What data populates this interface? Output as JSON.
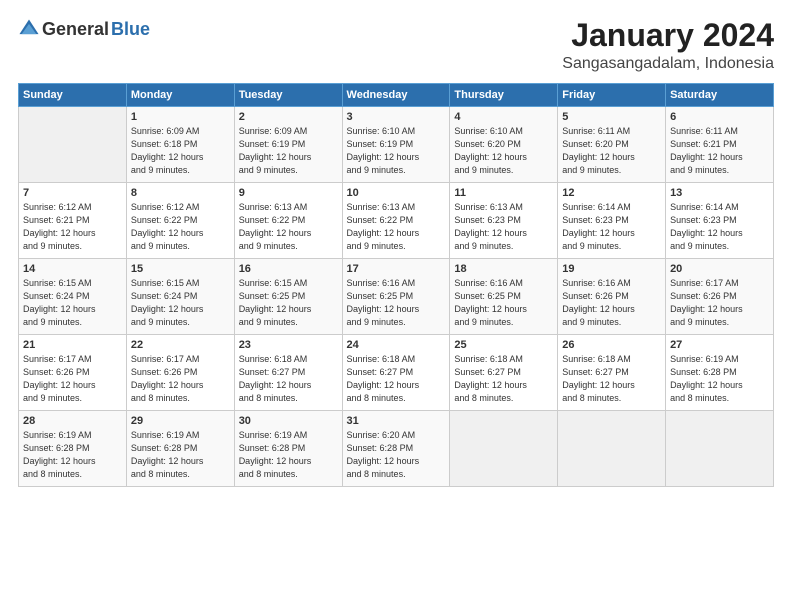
{
  "logo": {
    "text_general": "General",
    "text_blue": "Blue"
  },
  "header": {
    "month": "January 2024",
    "location": "Sangasangadalam, Indonesia"
  },
  "weekdays": [
    "Sunday",
    "Monday",
    "Tuesday",
    "Wednesday",
    "Thursday",
    "Friday",
    "Saturday"
  ],
  "weeks": [
    [
      {
        "day": "",
        "info": ""
      },
      {
        "day": "1",
        "info": "Sunrise: 6:09 AM\nSunset: 6:18 PM\nDaylight: 12 hours\nand 9 minutes."
      },
      {
        "day": "2",
        "info": "Sunrise: 6:09 AM\nSunset: 6:19 PM\nDaylight: 12 hours\nand 9 minutes."
      },
      {
        "day": "3",
        "info": "Sunrise: 6:10 AM\nSunset: 6:19 PM\nDaylight: 12 hours\nand 9 minutes."
      },
      {
        "day": "4",
        "info": "Sunrise: 6:10 AM\nSunset: 6:20 PM\nDaylight: 12 hours\nand 9 minutes."
      },
      {
        "day": "5",
        "info": "Sunrise: 6:11 AM\nSunset: 6:20 PM\nDaylight: 12 hours\nand 9 minutes."
      },
      {
        "day": "6",
        "info": "Sunrise: 6:11 AM\nSunset: 6:21 PM\nDaylight: 12 hours\nand 9 minutes."
      }
    ],
    [
      {
        "day": "7",
        "info": "Sunrise: 6:12 AM\nSunset: 6:21 PM\nDaylight: 12 hours\nand 9 minutes."
      },
      {
        "day": "8",
        "info": "Sunrise: 6:12 AM\nSunset: 6:22 PM\nDaylight: 12 hours\nand 9 minutes."
      },
      {
        "day": "9",
        "info": "Sunrise: 6:13 AM\nSunset: 6:22 PM\nDaylight: 12 hours\nand 9 minutes."
      },
      {
        "day": "10",
        "info": "Sunrise: 6:13 AM\nSunset: 6:22 PM\nDaylight: 12 hours\nand 9 minutes."
      },
      {
        "day": "11",
        "info": "Sunrise: 6:13 AM\nSunset: 6:23 PM\nDaylight: 12 hours\nand 9 minutes."
      },
      {
        "day": "12",
        "info": "Sunrise: 6:14 AM\nSunset: 6:23 PM\nDaylight: 12 hours\nand 9 minutes."
      },
      {
        "day": "13",
        "info": "Sunrise: 6:14 AM\nSunset: 6:23 PM\nDaylight: 12 hours\nand 9 minutes."
      }
    ],
    [
      {
        "day": "14",
        "info": "Sunrise: 6:15 AM\nSunset: 6:24 PM\nDaylight: 12 hours\nand 9 minutes."
      },
      {
        "day": "15",
        "info": "Sunrise: 6:15 AM\nSunset: 6:24 PM\nDaylight: 12 hours\nand 9 minutes."
      },
      {
        "day": "16",
        "info": "Sunrise: 6:15 AM\nSunset: 6:25 PM\nDaylight: 12 hours\nand 9 minutes."
      },
      {
        "day": "17",
        "info": "Sunrise: 6:16 AM\nSunset: 6:25 PM\nDaylight: 12 hours\nand 9 minutes."
      },
      {
        "day": "18",
        "info": "Sunrise: 6:16 AM\nSunset: 6:25 PM\nDaylight: 12 hours\nand 9 minutes."
      },
      {
        "day": "19",
        "info": "Sunrise: 6:16 AM\nSunset: 6:26 PM\nDaylight: 12 hours\nand 9 minutes."
      },
      {
        "day": "20",
        "info": "Sunrise: 6:17 AM\nSunset: 6:26 PM\nDaylight: 12 hours\nand 9 minutes."
      }
    ],
    [
      {
        "day": "21",
        "info": "Sunrise: 6:17 AM\nSunset: 6:26 PM\nDaylight: 12 hours\nand 9 minutes."
      },
      {
        "day": "22",
        "info": "Sunrise: 6:17 AM\nSunset: 6:26 PM\nDaylight: 12 hours\nand 8 minutes."
      },
      {
        "day": "23",
        "info": "Sunrise: 6:18 AM\nSunset: 6:27 PM\nDaylight: 12 hours\nand 8 minutes."
      },
      {
        "day": "24",
        "info": "Sunrise: 6:18 AM\nSunset: 6:27 PM\nDaylight: 12 hours\nand 8 minutes."
      },
      {
        "day": "25",
        "info": "Sunrise: 6:18 AM\nSunset: 6:27 PM\nDaylight: 12 hours\nand 8 minutes."
      },
      {
        "day": "26",
        "info": "Sunrise: 6:18 AM\nSunset: 6:27 PM\nDaylight: 12 hours\nand 8 minutes."
      },
      {
        "day": "27",
        "info": "Sunrise: 6:19 AM\nSunset: 6:28 PM\nDaylight: 12 hours\nand 8 minutes."
      }
    ],
    [
      {
        "day": "28",
        "info": "Sunrise: 6:19 AM\nSunset: 6:28 PM\nDaylight: 12 hours\nand 8 minutes."
      },
      {
        "day": "29",
        "info": "Sunrise: 6:19 AM\nSunset: 6:28 PM\nDaylight: 12 hours\nand 8 minutes."
      },
      {
        "day": "30",
        "info": "Sunrise: 6:19 AM\nSunset: 6:28 PM\nDaylight: 12 hours\nand 8 minutes."
      },
      {
        "day": "31",
        "info": "Sunrise: 6:20 AM\nSunset: 6:28 PM\nDaylight: 12 hours\nand 8 minutes."
      },
      {
        "day": "",
        "info": ""
      },
      {
        "day": "",
        "info": ""
      },
      {
        "day": "",
        "info": ""
      }
    ]
  ]
}
